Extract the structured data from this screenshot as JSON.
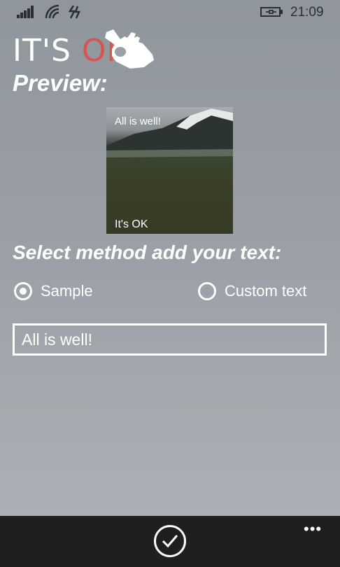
{
  "status_bar": {
    "time": "21:09",
    "icons": [
      "signal-icon",
      "wifi-icon",
      "data-icon",
      "battery-icon"
    ]
  },
  "logo": {
    "its": "IT'S ",
    "ok": "OK",
    "icon": "ok-hand-icon",
    "accent_color": "#d9534f"
  },
  "preview": {
    "heading": "Preview:",
    "top_text": "All is well!",
    "bottom_text": "It's OK"
  },
  "method": {
    "heading": "Select method add your text:",
    "options": [
      {
        "label": "Sample",
        "selected": true
      },
      {
        "label": "Custom text",
        "selected": false
      }
    ]
  },
  "text_input": {
    "value": "All is well!"
  },
  "app_bar": {
    "confirm_icon": "check-icon",
    "more_label": "•••",
    "background": "#1f1f1f"
  }
}
